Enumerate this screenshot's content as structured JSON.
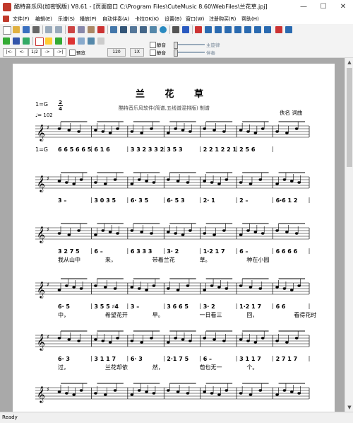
{
  "window": {
    "title": "酷特音乐风(加密钢版) V8.61 - [页面窗口  C:\\Program Files\\CuteMusic 8.60\\WebFiles\\兰花草.jpj]",
    "min_icon": "minimize-icon",
    "max_icon": "maximize-icon",
    "close_icon": "close-icon"
  },
  "menu": [
    "文件(F)",
    "编辑(E)",
    "乐谱(S)",
    "播放(P)",
    "自动伴奏(A)",
    "卡拉OK(K)",
    "设置(B)",
    "窗口(W)",
    "注册购买(R)",
    "帮助(H)"
  ],
  "toolbar3": {
    "nav_first": "|<-",
    "nav_prev": "<-",
    "page": "1/2",
    "nav_next": "->",
    "nav_last": "->|",
    "preview_label": "预览",
    "tempo": "120",
    "speed": "1X",
    "mute1_label": "静音",
    "mute2_label": "静音",
    "slider1_label": "主旋律",
    "slider2_label": "伴奏"
  },
  "score": {
    "title": "兰 花 草",
    "key": "1=G",
    "time_top": "2",
    "time_bottom": "4",
    "tempo_mark": "♩= 102",
    "subtitle": "酷特音乐风软件(简谱,五线谱混排版) 制谱",
    "composer": "佚名  词曲",
    "jianpu_key_row2": "1=G",
    "rows": [
      {
        "jianpu": [
          "6 6 5 6 6 5",
          "6 1 6",
          "3 3 2 3 3 2",
          "3 5 3",
          "2 2 1 2 2 1",
          "2  5 6"
        ],
        "lyrics": []
      },
      {
        "jianpu": [
          "3  –",
          "3  0 3 5",
          "6·  3 5",
          "6·  5 3",
          "2·  1",
          "2  –",
          "6·6 1 2"
        ],
        "lyrics": []
      },
      {
        "jianpu": [
          "3 2 7 5",
          "6  –",
          "6 3 3 3",
          "3·  2",
          "1·2 1 7",
          "6  –",
          "6 6 6 6"
        ],
        "lyrics": [
          "我从山中",
          "来，",
          "带着兰花",
          "草。",
          "种在小园"
        ]
      },
      {
        "jianpu": [
          "6·  5",
          "3 5 5 ♯4",
          "3  –",
          "3 6 6 5",
          "3·  2",
          "1·2 1 7",
          "6 6"
        ],
        "lyrics": [
          "中，",
          "希望花开",
          "早。",
          "一日看三",
          "回，",
          "看得花时"
        ]
      },
      {
        "jianpu": [
          "6·  3",
          "3 1 1 7",
          "6·  3",
          "2·1 7 5",
          "6  –",
          "3 1 1 7",
          "2 7 1 7"
        ],
        "lyrics": [
          "过，",
          "兰花却依",
          "然，",
          "苞也无一",
          "个。"
        ]
      }
    ]
  },
  "status": "Ready"
}
